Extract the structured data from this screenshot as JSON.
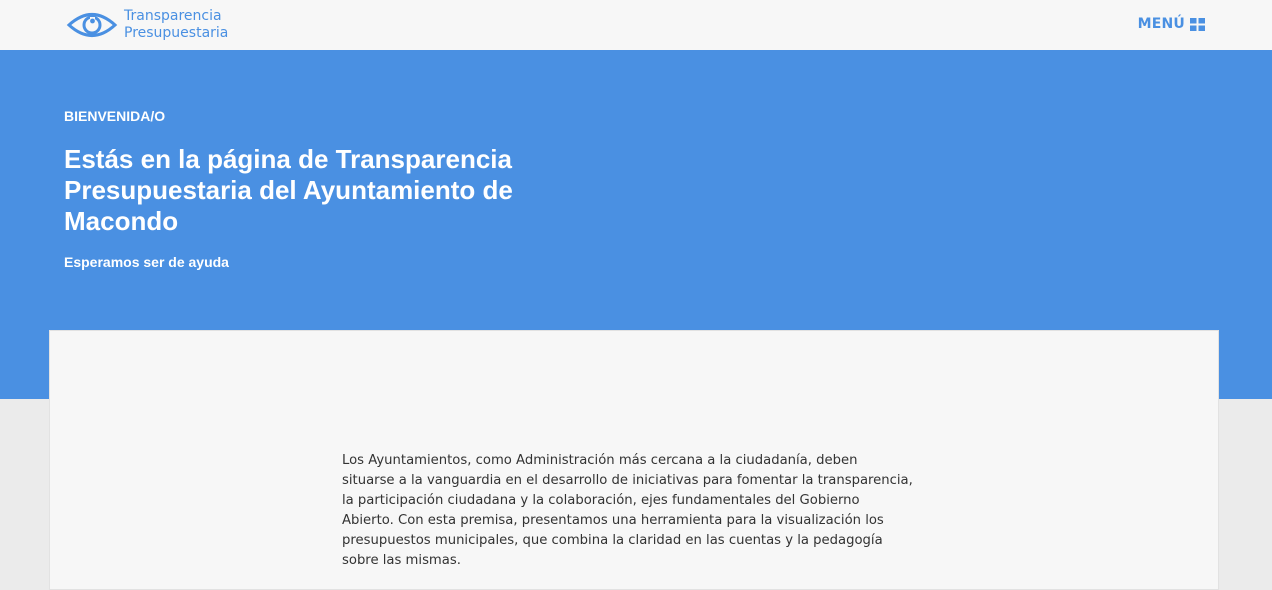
{
  "header": {
    "logo": {
      "line1": "Transparencia",
      "line2": "Presupuestaria",
      "icon": "eye-icon"
    },
    "menu": {
      "label": "MENÚ",
      "icon": "grid-icon"
    }
  },
  "hero": {
    "kicker": "BIENVENIDA/O",
    "title": "Estás en la página de Transparencia Presupuestaria del Ayuntamiento de Macondo",
    "subtitle": "Esperamos ser de ayuda"
  },
  "intro": {
    "text": "Los Ayuntamientos, como Administración más cercana a la ciudadanía, deben situarse a la vanguardia en el desarrollo de iniciativas para fomentar la transparencia, la participación ciudadana y la colaboración, ejes fundamentales del Gobierno Abierto. Con esta premisa, presentamos una herramienta para la visualización los presupuestos municipales, que combina la claridad en las cuentas y la pedagogía sobre las mismas."
  },
  "colors": {
    "brand": "#4a90e2",
    "header_bg": "#f7f7f7",
    "page_bg": "#ebebeb",
    "text": "#333333"
  }
}
